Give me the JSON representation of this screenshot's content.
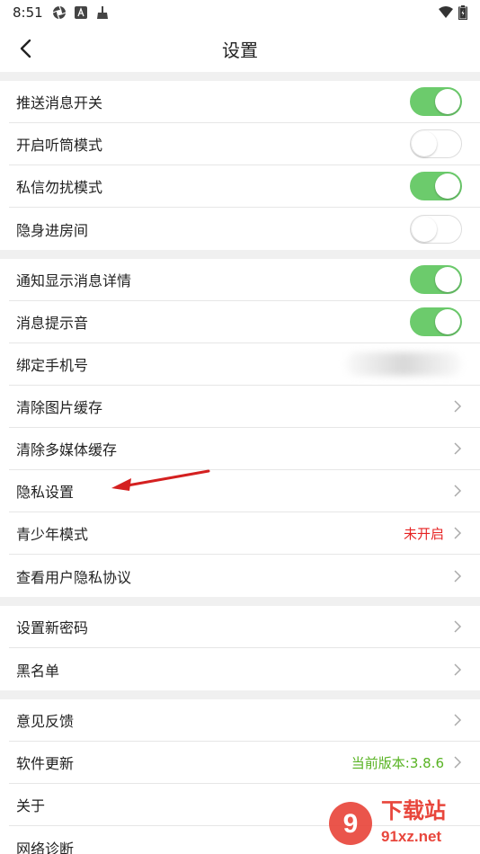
{
  "status_bar": {
    "time": "8:51"
  },
  "header": {
    "title": "设置"
  },
  "groups": [
    {
      "rows": [
        {
          "label": "推送消息开关",
          "toggle": "on"
        },
        {
          "label": "开启听筒模式",
          "toggle": "off"
        },
        {
          "label": "私信勿扰模式",
          "toggle": "on"
        },
        {
          "label": "隐身进房间",
          "toggle": "off"
        }
      ]
    },
    {
      "rows": [
        {
          "label": "通知显示消息详情",
          "toggle": "on"
        },
        {
          "label": "消息提示音",
          "toggle": "on"
        },
        {
          "label": "绑定手机号"
        },
        {
          "label": "清除图片缓存"
        },
        {
          "label": "清除多媒体缓存"
        },
        {
          "label": "隐私设置"
        },
        {
          "label": "青少年模式",
          "value": "未开启"
        },
        {
          "label": "查看用户隐私协议"
        }
      ]
    },
    {
      "rows": [
        {
          "label": "设置新密码"
        },
        {
          "label": "黑名单"
        }
      ]
    },
    {
      "rows": [
        {
          "label": "意见反馈"
        },
        {
          "label": "软件更新",
          "value": "当前版本:3.8.6"
        },
        {
          "label": "关于"
        },
        {
          "label": "网络诊断"
        }
      ]
    }
  ],
  "watermark": {
    "brand": "下载站",
    "site": "91xz.net",
    "logo_text": "9"
  },
  "colors": {
    "toggle_on": "#6ccb6c",
    "value_red": "#e62222",
    "value_green": "#58b323",
    "annotation_arrow": "#d42020"
  }
}
